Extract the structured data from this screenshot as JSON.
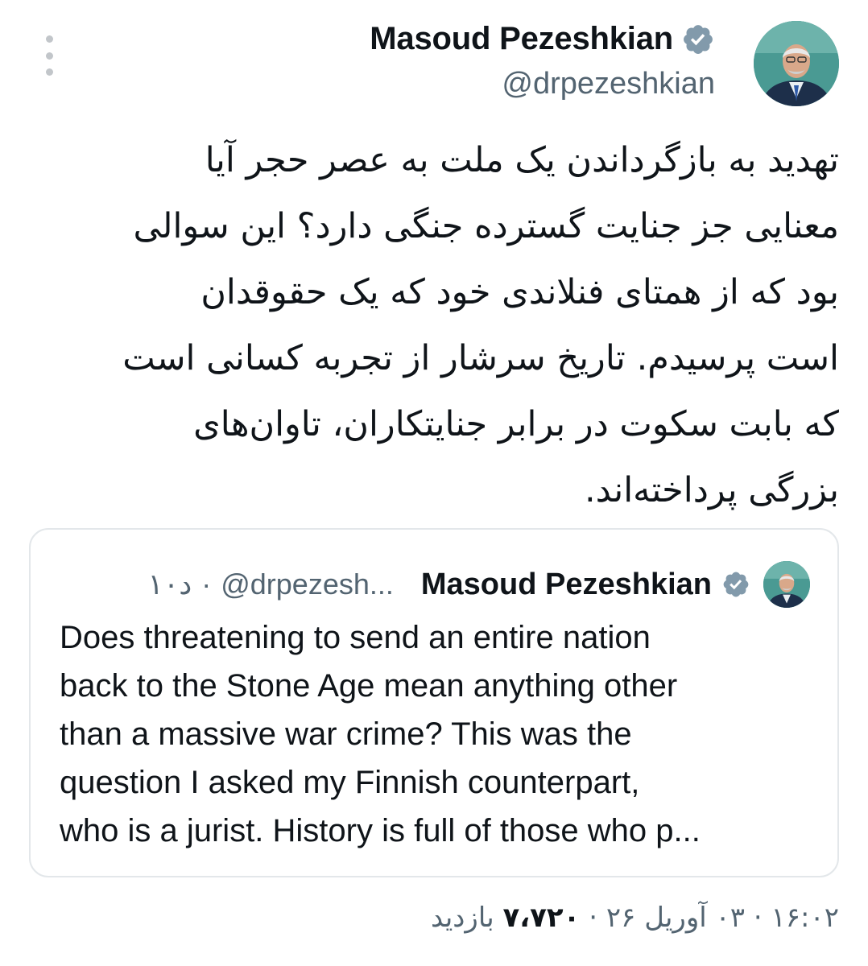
{
  "author": {
    "name": "Masoud Pezeshkian",
    "handle": "@drpezeshkian"
  },
  "tweet": {
    "lines": [
      "تهدید به بازگرداندن یک ملت به عصر حجر آیا",
      "معنایی جز جنایت گسترده جنگی دارد؟ این سوالی",
      "بود که از همتای فنلاندی خود که یک حقوقدان",
      "است پرسیدم. تاریخ سرشار از تجربه کسانی است",
      "که بابت سکوت در برابر جنایتکاران، تاوان‌های",
      "بزرگی پرداخته‌اند."
    ]
  },
  "quote": {
    "name": "Masoud Pezeshkian",
    "handle": "@drpezesh...",
    "separator": "·",
    "age": "۱۰د",
    "lines": [
      "Does threatening to send an entire nation",
      "back to the Stone Age mean anything other",
      "than a massive war crime? This was the",
      "question I asked my Finnish counterpart,",
      "who is a jurist. History is full of those who p..."
    ]
  },
  "footer": {
    "time": "۱۶:۰۲",
    "sep1": "·",
    "date": "۰۳ آوریل ۲۶",
    "sep2": "·",
    "views_count": "۷،۷۲۰",
    "views_label": "بازدید"
  },
  "colors": {
    "text": "#0f1419",
    "secondary": "#536471",
    "verified_badge": "#829aab",
    "card_border": "#e3e7ea"
  },
  "icons": [
    "more-vertical-icon",
    "verified-badge-icon"
  ]
}
